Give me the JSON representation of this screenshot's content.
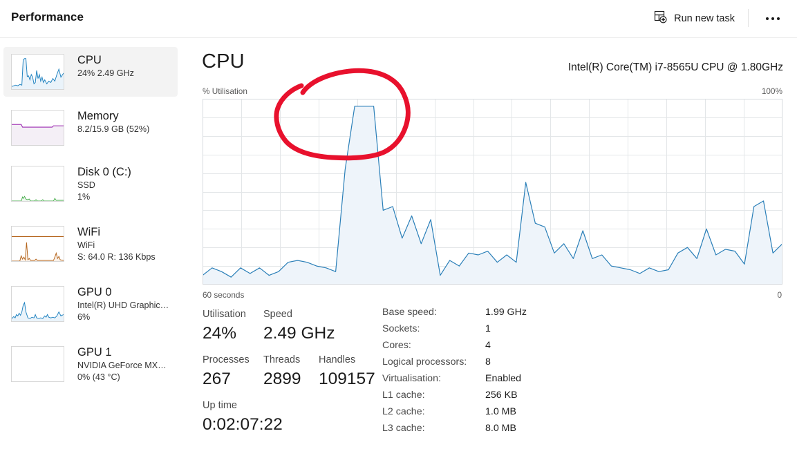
{
  "window": {
    "title": "Performance"
  },
  "toolbar": {
    "run_new_task_label": "Run new task",
    "run_new_task_icon": "new-task-window-plus-icon",
    "more_label": "",
    "more_icon": "ellipsis-icon"
  },
  "sidebar": {
    "items": [
      {
        "name": "CPU",
        "sub1": "24%  2.49 GHz",
        "sub2": "",
        "selected": true,
        "color": "#1f82c0",
        "fill": "#eef5fb",
        "graph": "cpu-thumb-graph"
      },
      {
        "name": "Memory",
        "sub1": "8.2/15.9 GB (52%)",
        "sub2": "",
        "selected": false,
        "color": "#9b27b0",
        "fill": "#f4eff6",
        "graph": "memory-thumb-graph"
      },
      {
        "name": "Disk 0 (C:)",
        "sub1": "SSD",
        "sub2": "1%",
        "selected": false,
        "color": "#4caf50",
        "fill": "#eef7ef",
        "graph": "disk-thumb-graph"
      },
      {
        "name": "WiFi",
        "sub1": "WiFi",
        "sub2": "S: 64.0 R: 136 Kbps",
        "selected": false,
        "color": "#b5651d",
        "fill": "#faf1e8",
        "graph": "wifi-thumb-graph"
      },
      {
        "name": "GPU 0",
        "sub1": "Intel(R) UHD Graphic…",
        "sub2": "6%",
        "selected": false,
        "color": "#1f82c0",
        "fill": "#eef5fb",
        "graph": "gpu0-thumb-graph"
      },
      {
        "name": "GPU 1",
        "sub1": "NVIDIA GeForce MX…",
        "sub2": "0%  (43 °C)",
        "selected": false,
        "color": "#1f82c0",
        "fill": "#eef5fb",
        "graph": "gpu1-thumb-graph"
      }
    ]
  },
  "main": {
    "heading": "CPU",
    "model": "Intel(R) Core(TM) i7-8565U CPU @ 1.80GHz",
    "y_axis_label": "% Utilisation",
    "y_axis_max": "100%",
    "x_axis_label": "60 seconds",
    "x_axis_min": "0",
    "stats": [
      {
        "label": "Utilisation",
        "value": "24%"
      },
      {
        "label": "Speed",
        "value": "2.49 GHz"
      },
      {
        "label": "Processes",
        "value": "267"
      },
      {
        "label": "Threads",
        "value": "2899"
      },
      {
        "label": "Handles",
        "value": "109157"
      },
      {
        "label": "Up time",
        "value": "0:02:07:22"
      }
    ],
    "info": [
      {
        "key": "Base speed:",
        "value": "1.99 GHz"
      },
      {
        "key": "Sockets:",
        "value": "1"
      },
      {
        "key": "Cores:",
        "value": "4"
      },
      {
        "key": "Logical processors:",
        "value": "8"
      },
      {
        "key": "Virtualisation:",
        "value": "Enabled"
      },
      {
        "key": "L1 cache:",
        "value": "256 KB"
      },
      {
        "key": "L2 cache:",
        "value": "1.0 MB"
      },
      {
        "key": "L3 cache:",
        "value": "8.0 MB"
      }
    ]
  },
  "annotation": {
    "shape": "hand-drawn-red-ellipse",
    "color": "#e8112d",
    "stroke_width": 7
  },
  "chart_data": {
    "type": "area",
    "title": "CPU % Utilisation",
    "xlabel": "60 seconds",
    "ylabel": "% Utilisation",
    "ylim": [
      0,
      100
    ],
    "xlim": [
      60,
      0
    ],
    "grid": true,
    "line_color": "#2a7fb8",
    "fill_color": "#eef4fa",
    "grid_color": "#e3e6e8",
    "legend": "none",
    "values": [
      5,
      9,
      7,
      4,
      9,
      6,
      9,
      5,
      7,
      12,
      13,
      12,
      10,
      9,
      7,
      62,
      96,
      96,
      96,
      40,
      42,
      25,
      37,
      22,
      35,
      5,
      13,
      10,
      17,
      16,
      18,
      12,
      16,
      12,
      55,
      33,
      31,
      17,
      22,
      14,
      29,
      14,
      16,
      10,
      9,
      8,
      6,
      9,
      7,
      8,
      17,
      20,
      14,
      30,
      16,
      19,
      18,
      11,
      42,
      45,
      17,
      22
    ]
  }
}
